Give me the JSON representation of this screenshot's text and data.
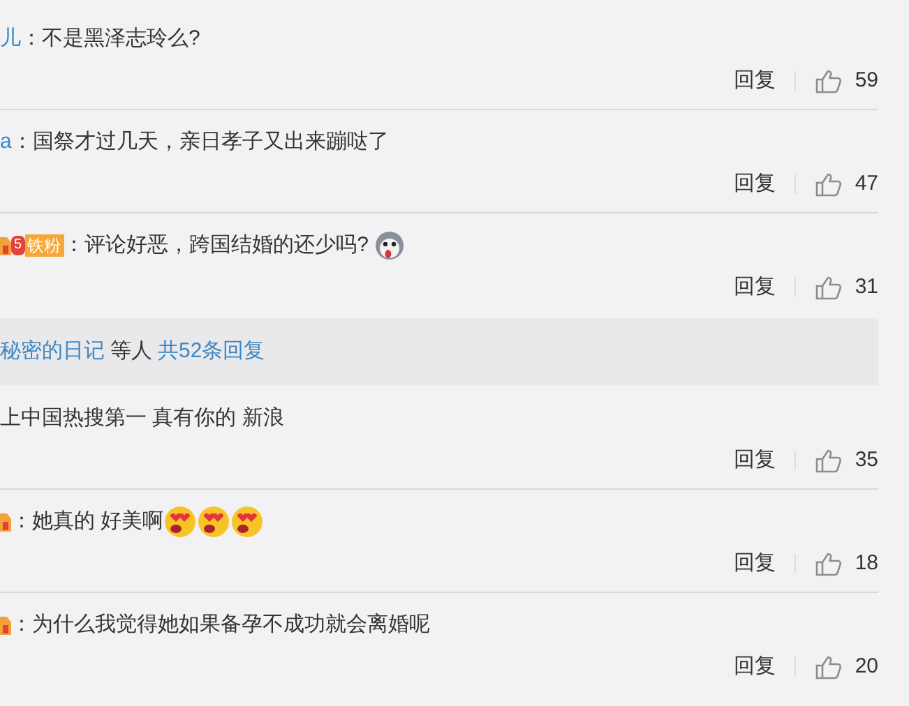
{
  "items": [
    {
      "kind": "comment",
      "username": "儿",
      "text": "：不是黑泽志玲么?",
      "reply": "回复",
      "likes": "59"
    },
    {
      "kind": "comment",
      "username": "a",
      "text": "：国祭才过几天，亲日孝子又出来蹦哒了",
      "reply": "回复",
      "likes": "47"
    },
    {
      "kind": "comment",
      "badge_icon": true,
      "level": "5",
      "badge": "铁粉",
      "text": "：评论好恶，跨国结婚的还少吗?",
      "emojis": [
        {
          "kind": "dog"
        }
      ],
      "reply": "回复",
      "likes": "31"
    },
    {
      "kind": "summary",
      "names": "秘密的日记",
      "others": "等人",
      "count": "共52条回复"
    },
    {
      "kind": "comment",
      "text": "上中国热搜第一 真有你的 新浪",
      "reply": "回复",
      "likes": "35"
    },
    {
      "kind": "comment",
      "badge_icon": true,
      "text": "：她真的 好美啊",
      "emojis": [
        {
          "kind": "heart-eyes"
        },
        {
          "kind": "heart-eyes"
        },
        {
          "kind": "heart-eyes"
        }
      ],
      "reply": "回复",
      "likes": "18"
    },
    {
      "kind": "comment",
      "badge_icon": true,
      "text": "：为什么我觉得她如果备孕不成功就会离婚呢",
      "reply": "回复",
      "likes": "20"
    }
  ]
}
